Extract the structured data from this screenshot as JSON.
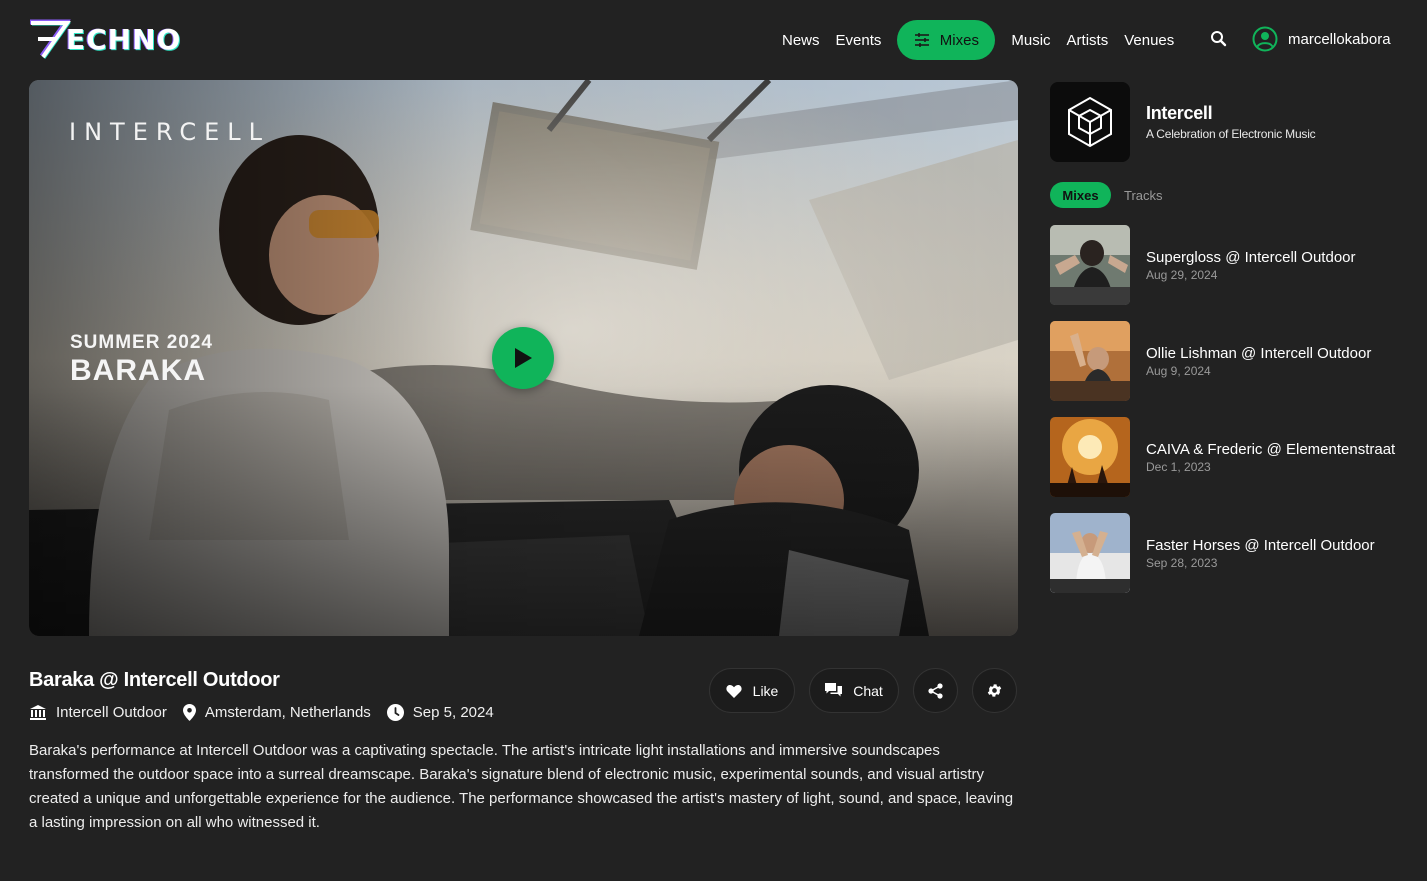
{
  "header": {
    "logo_text": "ECHNO",
    "nav": [
      "News",
      "Events",
      "Mixes",
      "Music",
      "Artists",
      "Venues"
    ],
    "active_nav": "Mixes",
    "username": "marcellokabora",
    "icons": {
      "search": "search-icon",
      "user": "user-circle-icon",
      "mixes": "sliders-icon"
    }
  },
  "hero": {
    "brand": "INTERCELL",
    "season": "SUMMER 2024",
    "artist": "BARAKA",
    "play_icon": "play-icon"
  },
  "mix": {
    "title": "Baraka @ Intercell Outdoor",
    "venue": "Intercell Outdoor",
    "location": "Amsterdam, Netherlands",
    "date": "Sep 5, 2024",
    "description": "Baraka's performance at Intercell Outdoor was a captivating spectacle. The artist's intricate light installations and immersive soundscapes transformed the outdoor space into a surreal dreamscape. Baraka's signature blend of electronic music, experimental sounds, and visual artistry created a unique and unforgettable experience for the audience. The performance showcased the artist's mastery of light, sound, and space, leaving a lasting impression on all who witnessed it."
  },
  "actions": {
    "like": "Like",
    "chat": "Chat",
    "icons": [
      "heart-icon",
      "chat-icon",
      "share-icon",
      "gear-icon"
    ]
  },
  "sidebar": {
    "channel_name": "Intercell",
    "channel_tagline": "A Celebration of Electronic Music",
    "tabs": [
      "Mixes",
      "Tracks"
    ],
    "active_tab": "Mixes",
    "items": [
      {
        "title": "Supergloss @ Intercell Outdoor",
        "date": "Aug 29, 2024"
      },
      {
        "title": "Ollie Lishman @ Intercell Outdoor",
        "date": "Aug 9, 2024"
      },
      {
        "title": "CAIVA & Frederic @ Elementenstraat",
        "date": "Dec 1, 2023"
      },
      {
        "title": "Faster Horses @ Intercell Outdoor",
        "date": "Sep 28, 2023"
      }
    ]
  },
  "colors": {
    "background": "#222222",
    "accent": "#10b45a",
    "muted": "#9a9a9a"
  }
}
